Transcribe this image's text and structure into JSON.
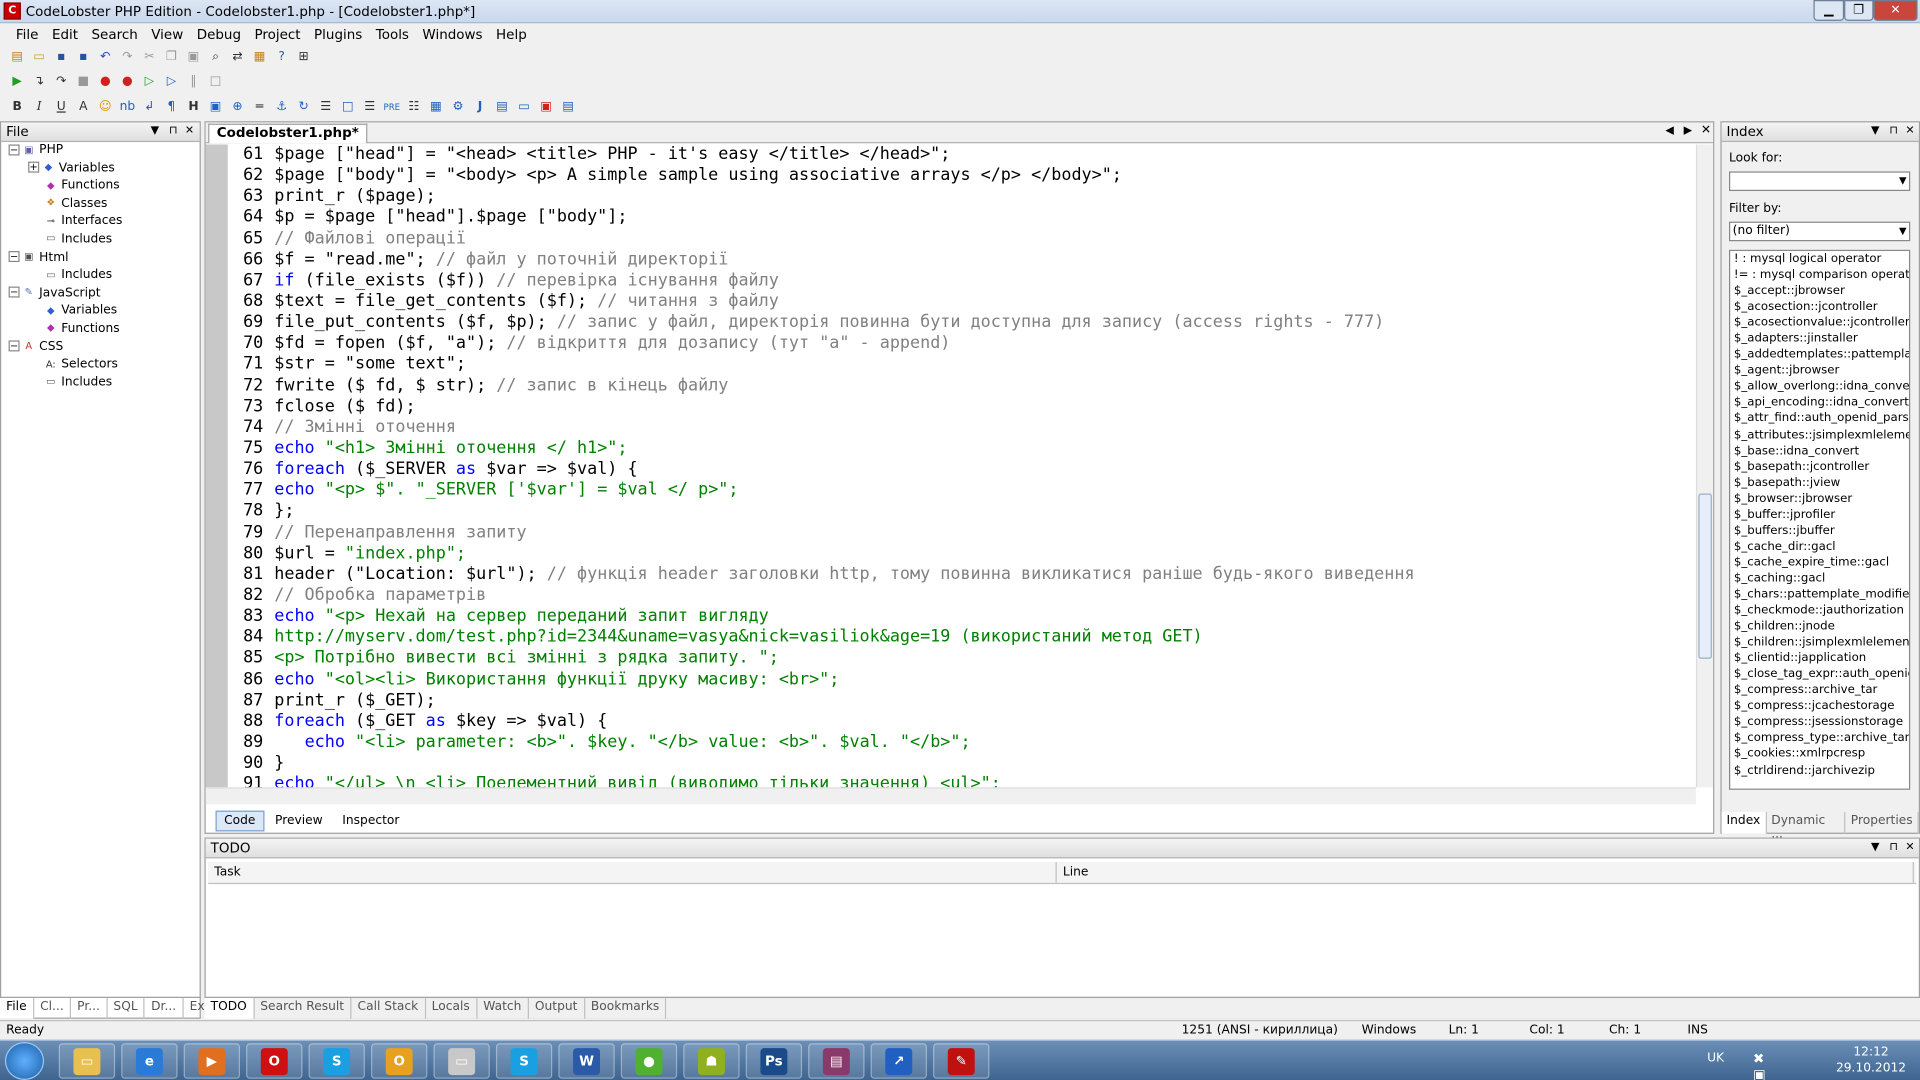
{
  "window": {
    "title": "CodeLobster PHP Edition - Codelobster1.php - [Codelobster1.php*]"
  },
  "menu": [
    "File",
    "Edit",
    "Search",
    "View",
    "Debug",
    "Project",
    "Plugins",
    "Tools",
    "Windows",
    "Help"
  ],
  "left_panel": {
    "title": "File",
    "tree": [
      {
        "label": "PHP",
        "level": 0,
        "icon": "php-icon"
      },
      {
        "label": "Variables",
        "level": 1,
        "icon": "variables-icon"
      },
      {
        "label": "Functions",
        "level": 1,
        "icon": "functions-icon"
      },
      {
        "label": "Classes",
        "level": 1,
        "icon": "classes-icon"
      },
      {
        "label": "Interfaces",
        "level": 1,
        "icon": "interfaces-icon"
      },
      {
        "label": "Includes",
        "level": 1,
        "icon": "includes-icon"
      },
      {
        "label": "Html",
        "level": 0,
        "icon": "html-icon"
      },
      {
        "label": "Includes",
        "level": 1,
        "icon": "includes-icon"
      },
      {
        "label": "JavaScript",
        "level": 0,
        "icon": "javascript-icon"
      },
      {
        "label": "Variables",
        "level": 1,
        "icon": "variables-icon"
      },
      {
        "label": "Functions",
        "level": 1,
        "icon": "functions-icon"
      },
      {
        "label": "CSS",
        "level": 0,
        "icon": "css-icon"
      },
      {
        "label": "Selectors",
        "level": 1,
        "icon": "selectors-icon"
      },
      {
        "label": "Includes",
        "level": 1,
        "icon": "includes-icon"
      }
    ],
    "tabs": [
      "File",
      "Cl...",
      "Pr...",
      "SQL",
      "Dr...",
      "Ex..."
    ]
  },
  "editor": {
    "tab": "Codelobster1.php*",
    "lines": [
      {
        "n": "61",
        "s": [
          [
            "p",
            "$page [\"head\"] = \"<head> <title> PHP - it's easy </title> </head>\";"
          ]
        ]
      },
      {
        "n": "62",
        "s": [
          [
            "p",
            "$page [\"body\"] = \"<body> <p> A simple sample using associative arrays </p> </body>\";"
          ]
        ]
      },
      {
        "n": "63",
        "s": [
          [
            "p",
            "print_r ($page);"
          ]
        ]
      },
      {
        "n": "64",
        "s": [
          [
            "p",
            "$p = $page [\"head\"].$page [\"body\"];"
          ]
        ]
      },
      {
        "n": "65",
        "s": [
          [
            "c",
            "// Файлові операції"
          ]
        ]
      },
      {
        "n": "66",
        "s": [
          [
            "p",
            "$f = \"read.me\"; "
          ],
          [
            "c",
            "// файл у поточній директорії"
          ]
        ]
      },
      {
        "n": "67",
        "s": [
          [
            "k",
            "if"
          ],
          [
            "p",
            " (file_exists ($f)) "
          ],
          [
            "c",
            "// перевірка існування файлу"
          ]
        ]
      },
      {
        "n": "68",
        "s": [
          [
            "p",
            "$text = file_get_contents ($f); "
          ],
          [
            "c",
            "// читання з файлу"
          ]
        ]
      },
      {
        "n": "69",
        "s": [
          [
            "p",
            "file_put_contents ($f, $p); "
          ],
          [
            "c",
            "// запис у файл, директорія повинна бути доступна для запису (access rights - 777)"
          ]
        ]
      },
      {
        "n": "70",
        "s": [
          [
            "p",
            "$fd = fopen ($f, \"a\"); "
          ],
          [
            "c",
            "// відкриття для дозапису (тут \"a\" - append)"
          ]
        ]
      },
      {
        "n": "71",
        "s": [
          [
            "p",
            "$str = \"some text\";"
          ]
        ]
      },
      {
        "n": "72",
        "s": [
          [
            "p",
            "fwrite ($ fd, $ str); "
          ],
          [
            "c",
            "// запис в кінець файлу"
          ]
        ]
      },
      {
        "n": "73",
        "s": [
          [
            "p",
            "fclose ($ fd);"
          ]
        ]
      },
      {
        "n": "74",
        "s": [
          [
            "c",
            "// Змінні оточення"
          ]
        ]
      },
      {
        "n": "75",
        "s": [
          [
            "k",
            "echo"
          ],
          [
            "s",
            " \"<h1> Змінні оточення </ h1>\";"
          ]
        ]
      },
      {
        "n": "76",
        "s": [
          [
            "k",
            "foreach"
          ],
          [
            "p",
            " ($_SERVER "
          ],
          [
            "k",
            "as"
          ],
          [
            "p",
            " $var => $val) {"
          ]
        ]
      },
      {
        "n": "77",
        "s": [
          [
            "k",
            "echo"
          ],
          [
            "s",
            " \"<p> $\". \"_SERVER ['$var'] = $val </ p>\";"
          ]
        ]
      },
      {
        "n": "78",
        "s": [
          [
            "p",
            "};"
          ]
        ]
      },
      {
        "n": "79",
        "s": [
          [
            "c",
            "// Перенаправлення запиту"
          ]
        ]
      },
      {
        "n": "80",
        "s": [
          [
            "p",
            "$url = "
          ],
          [
            "s",
            "\"index.php\";"
          ]
        ]
      },
      {
        "n": "81",
        "s": [
          [
            "p",
            "header (\"Location: $url\"); "
          ],
          [
            "c",
            "// функція header заголовки http, тому повинна викликатися раніше будь-якого виведення"
          ]
        ]
      },
      {
        "n": "82",
        "s": [
          [
            "c",
            "// Обробка параметрів"
          ]
        ]
      },
      {
        "n": "83",
        "s": [
          [
            "k",
            "echo"
          ],
          [
            "s",
            " \"<p> Нехай на сервер переданий запит вигляду"
          ]
        ]
      },
      {
        "n": "84",
        "s": [
          [
            "s",
            "http://myserv.dom/test.php?id=2344&uname=vasya&nick=vasiliok&age=19 (використаний метод GET)"
          ]
        ]
      },
      {
        "n": "85",
        "s": [
          [
            "s",
            "<p> Потрібно вивести всі змінні з рядка запиту. \";"
          ]
        ]
      },
      {
        "n": "86",
        "s": [
          [
            "k",
            "echo"
          ],
          [
            "s",
            " \"<ol><li> Використання функції друку масиву: <br>\";"
          ]
        ]
      },
      {
        "n": "87",
        "s": [
          [
            "p",
            "print_r ($_GET);"
          ]
        ]
      },
      {
        "n": "88",
        "s": [
          [
            "k",
            "foreach"
          ],
          [
            "p",
            " ($_GET "
          ],
          [
            "k",
            "as"
          ],
          [
            "p",
            " $key => $val) {"
          ]
        ]
      },
      {
        "n": "89",
        "s": [
          [
            "p",
            "   "
          ],
          [
            "k",
            "echo"
          ],
          [
            "s",
            " \"<li> parameter: <b>\". $key. \"</b> value: <b>\". $val. \"</b>\";"
          ]
        ]
      },
      {
        "n": "90",
        "s": [
          [
            "p",
            "}"
          ]
        ]
      },
      {
        "n": "91",
        "s": [
          [
            "k",
            "echo"
          ],
          [
            "s",
            " \"</ul> \\n <li> Поелементний вивід (виводимо тільки значення) <ul>\";"
          ]
        ]
      }
    ],
    "bottom_tabs": [
      "Code",
      "Preview",
      "Inspector"
    ]
  },
  "right_panel": {
    "title": "Index",
    "look_for_label": "Look for:",
    "look_for_value": "",
    "filter_label": "Filter by:",
    "filter_value": "(no filter)",
    "items": [
      "! : mysql logical operator",
      "!= : mysql comparison operator",
      "$_accept::jbrowser",
      "$_acosection::jcontroller",
      "$_acosectionvalue::jcontroller",
      "$_adapters::jinstaller",
      "$_addedtemplates::pattemplate",
      "$_agent::jbrowser",
      "$_allow_overlong::idna_convert",
      "$_api_encoding::idna_convert",
      "$_attr_find::auth_openid_parse",
      "$_attributes::jsimplexmlelement",
      "$_base::idna_convert",
      "$_basepath::jcontroller",
      "$_basepath::jview",
      "$_browser::jbrowser",
      "$_buffer::jprofiler",
      "$_buffers::jbuffer",
      "$_cache_dir::gacl",
      "$_cache_expire_time::gacl",
      "$_caching::gacl",
      "$_chars::pattemplate_modifier",
      "$_checkmode::jauthorization",
      "$_children::jnode",
      "$_children::jsimplexmlelement",
      "$_clientid::japplication",
      "$_close_tag_expr::auth_openid",
      "$_compress::archive_tar",
      "$_compress::jcachestorage",
      "$_compress::jsessionstorage",
      "$_compress_type::archive_tar",
      "$_cookies::xmlrpcresp",
      "$_ctrldirend::jarchivezip"
    ],
    "tabs": [
      "Index",
      "Dynamic ...",
      "Properties"
    ]
  },
  "todo": {
    "title": "TODO",
    "columns": [
      "Task",
      "Line"
    ]
  },
  "bottom_tabs": [
    "TODO",
    "Search Result",
    "Call Stack",
    "Locals",
    "Watch",
    "Output",
    "Bookmarks"
  ],
  "status": {
    "left": "Ready",
    "encoding": "1251  (ANSI - кириллица)",
    "line_ending": "Windows",
    "ln": "Ln: 1",
    "col": "Col: 1",
    "ch": "Ch: 1",
    "mode": "INS"
  },
  "taskbar": {
    "apps": [
      {
        "name": "explorer",
        "color": "#e8c050",
        "glyph": "▭"
      },
      {
        "name": "internet-explorer",
        "color": "#2a7ad8",
        "glyph": "e"
      },
      {
        "name": "media-player",
        "color": "#e07020",
        "glyph": "▶"
      },
      {
        "name": "opera",
        "color": "#d01010",
        "glyph": "O"
      },
      {
        "name": "skype",
        "color": "#1aa0e0",
        "glyph": "S"
      },
      {
        "name": "outlook",
        "color": "#e8a020",
        "glyph": "O"
      },
      {
        "name": "documents",
        "color": "#c8c8c8",
        "glyph": "▭"
      },
      {
        "name": "skype-2",
        "color": "#1aa0e0",
        "glyph": "S"
      },
      {
        "name": "word",
        "color": "#2a5aa8",
        "glyph": "W"
      },
      {
        "name": "app-green",
        "color": "#50b030",
        "glyph": "●"
      },
      {
        "name": "app-robot",
        "color": "#90b020",
        "glyph": "☗"
      },
      {
        "name": "photoshop",
        "color": "#1a4a8a",
        "glyph": "Ps"
      },
      {
        "name": "winrar",
        "color": "#8a3a6a",
        "glyph": "▤"
      },
      {
        "name": "app-chart",
        "color": "#2060c0",
        "glyph": "↗"
      },
      {
        "name": "codelobster",
        "color": "#c01010",
        "glyph": "✎"
      }
    ],
    "lang": "UK",
    "time": "12:12",
    "date": "29.10.2012"
  },
  "colors": {
    "keyword": "#0000ff",
    "string": "#008000",
    "comment": "#808080"
  }
}
